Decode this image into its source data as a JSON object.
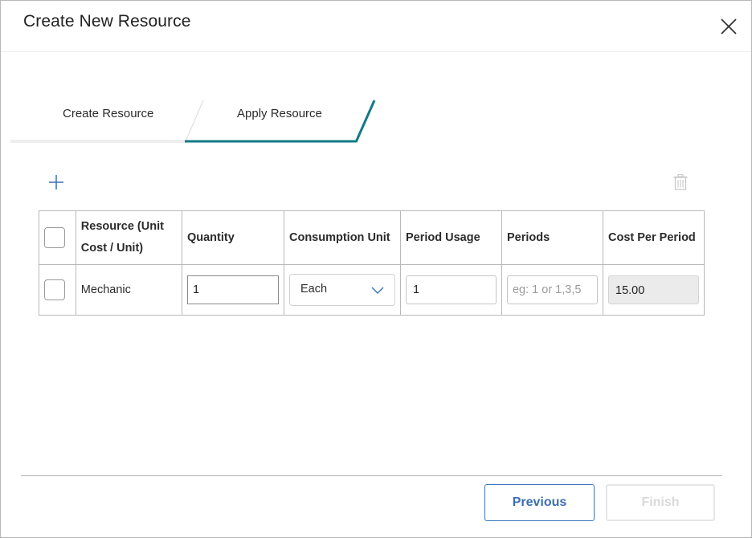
{
  "dialog": {
    "title": "Create New Resource"
  },
  "stepper": {
    "steps": [
      {
        "label": "Create Resource",
        "active": false
      },
      {
        "label": "Apply Resource",
        "active": true
      }
    ],
    "accent_color": "#127a86"
  },
  "toolbar": {
    "add_icon": "plus-icon",
    "delete_icon": "trash-icon"
  },
  "table": {
    "columns": [
      "Resource (Unit Cost / Unit)",
      "Quantity",
      "Consumption Unit",
      "Period Usage",
      "Periods",
      "Cost Per Period"
    ],
    "rows": [
      {
        "resource": "Mechanic",
        "quantity": "1",
        "consumption_unit": "Each",
        "period_usage": "1",
        "periods_value": "",
        "periods_placeholder": "eg: 1 or 1,3,5",
        "cost_per_period": "15.00"
      }
    ]
  },
  "footer": {
    "previous_label": "Previous",
    "finish_label": "Finish"
  }
}
